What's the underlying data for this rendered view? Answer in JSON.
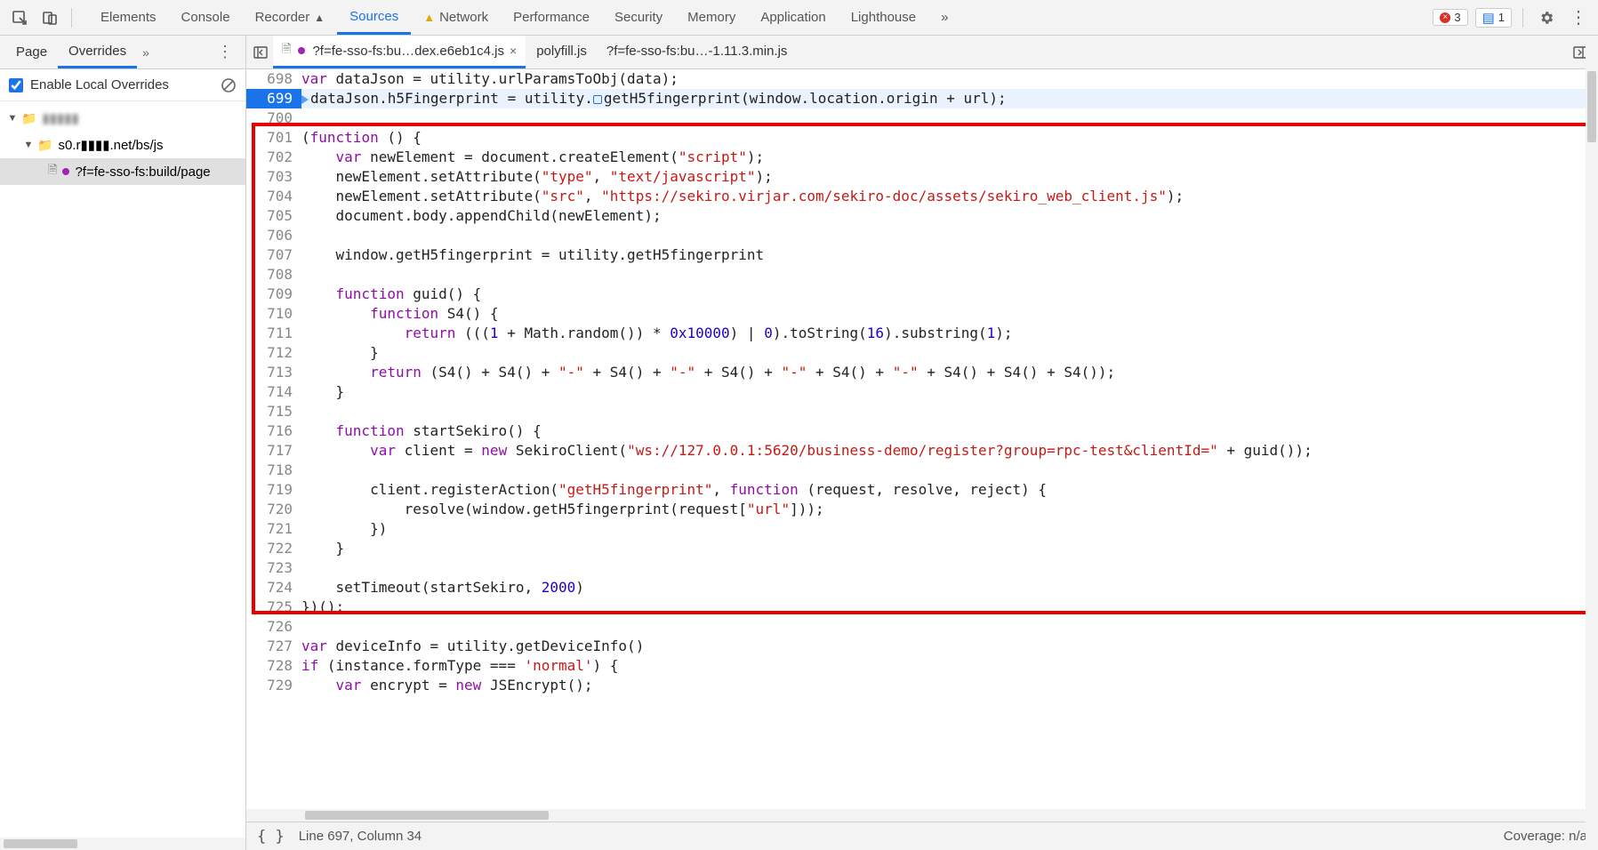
{
  "toolbar": {
    "tabs": [
      "Elements",
      "Console",
      "Recorder",
      "Sources",
      "Network",
      "Performance",
      "Security",
      "Memory",
      "Application",
      "Lighthouse"
    ],
    "active": 3,
    "recorder_flag": "▲",
    "network_warn": true,
    "more": "»",
    "error_count": "3",
    "msg_count": "1"
  },
  "sidebar": {
    "tabs": [
      "Page",
      "Overrides"
    ],
    "active": 1,
    "more": "»",
    "enable_overrides": "Enable Local Overrides",
    "tree": {
      "root_blur": "▮▮▮▮▮",
      "domain": "s0.r▮▮▮▮.net/bs/js",
      "file": "?f=fe-sso-fs:build/page"
    }
  },
  "editor": {
    "tabs": [
      "?f=fe-sso-fs:bu…dex.e6eb1c4.js",
      "polyfill.js",
      "?f=fe-sso-fs:bu…-1.11.3.min.js"
    ],
    "active": 0,
    "status_line": "Line 697, Column 34",
    "coverage": "Coverage: n/a",
    "first_line_no": 698,
    "lines": [
      {
        "n": 698,
        "seg": [
          [
            "kw",
            "var"
          ],
          [
            "plain",
            " dataJson "
          ],
          [
            "plain",
            "= utility.urlParamsToObj(data);"
          ]
        ]
      },
      {
        "n": 699,
        "hl": true,
        "bp": true,
        "seg": [
          [
            "plain",
            "dataJson.h5Fingerprint "
          ],
          [
            "plain",
            "= utility."
          ],
          [
            "brk",
            ""
          ],
          [
            "plain",
            "getH5fingerprint(window.location.origin "
          ],
          [
            "plain",
            "+ url);"
          ]
        ]
      },
      {
        "n": 700,
        "seg": []
      },
      {
        "n": 701,
        "seg": [
          [
            "plain",
            "("
          ],
          [
            "kw",
            "function"
          ],
          [
            "plain",
            " () {"
          ]
        ]
      },
      {
        "n": 702,
        "seg": [
          [
            "plain",
            "    "
          ],
          [
            "kw",
            "var"
          ],
          [
            "plain",
            " newElement "
          ],
          [
            "plain",
            "= document.createElement("
          ],
          [
            "str",
            "\"script\""
          ],
          [
            "plain",
            ");"
          ]
        ]
      },
      {
        "n": 703,
        "seg": [
          [
            "plain",
            "    newElement.setAttribute("
          ],
          [
            "str",
            "\"type\""
          ],
          [
            "plain",
            ", "
          ],
          [
            "str",
            "\"text/javascript\""
          ],
          [
            "plain",
            ");"
          ]
        ]
      },
      {
        "n": 704,
        "seg": [
          [
            "plain",
            "    newElement.setAttribute("
          ],
          [
            "str",
            "\"src\""
          ],
          [
            "plain",
            ", "
          ],
          [
            "str",
            "\"https://sekiro.virjar.com/sekiro-doc/assets/sekiro_web_client.js\""
          ],
          [
            "plain",
            ");"
          ]
        ]
      },
      {
        "n": 705,
        "seg": [
          [
            "plain",
            "    document.body.appendChild(newElement);"
          ]
        ]
      },
      {
        "n": 706,
        "seg": []
      },
      {
        "n": 707,
        "seg": [
          [
            "plain",
            "    window.getH5fingerprint "
          ],
          [
            "plain",
            "= utility.getH5fingerprint"
          ]
        ]
      },
      {
        "n": 708,
        "seg": []
      },
      {
        "n": 709,
        "seg": [
          [
            "plain",
            "    "
          ],
          [
            "kw",
            "function"
          ],
          [
            "plain",
            " guid() {"
          ]
        ]
      },
      {
        "n": 710,
        "seg": [
          [
            "plain",
            "        "
          ],
          [
            "kw",
            "function"
          ],
          [
            "plain",
            " S4() {"
          ]
        ]
      },
      {
        "n": 711,
        "seg": [
          [
            "plain",
            "            "
          ],
          [
            "kw",
            "return"
          ],
          [
            "plain",
            " ((("
          ],
          [
            "num",
            "1"
          ],
          [
            "plain",
            " + Math.random()) * "
          ],
          [
            "num",
            "0x10000"
          ],
          [
            "plain",
            ") | "
          ],
          [
            "num",
            "0"
          ],
          [
            "plain",
            ").toString("
          ],
          [
            "num",
            "16"
          ],
          [
            "plain",
            ").substring("
          ],
          [
            "num",
            "1"
          ],
          [
            "plain",
            ");"
          ]
        ]
      },
      {
        "n": 712,
        "seg": [
          [
            "plain",
            "        }"
          ]
        ]
      },
      {
        "n": 713,
        "seg": [
          [
            "plain",
            "        "
          ],
          [
            "kw",
            "return"
          ],
          [
            "plain",
            " (S4() + S4() + "
          ],
          [
            "str",
            "\"-\""
          ],
          [
            "plain",
            " + S4() + "
          ],
          [
            "str",
            "\"-\""
          ],
          [
            "plain",
            " + S4() + "
          ],
          [
            "str",
            "\"-\""
          ],
          [
            "plain",
            " + S4() + "
          ],
          [
            "str",
            "\"-\""
          ],
          [
            "plain",
            " + S4() + S4() + S4());"
          ]
        ]
      },
      {
        "n": 714,
        "seg": [
          [
            "plain",
            "    }"
          ]
        ]
      },
      {
        "n": 715,
        "seg": []
      },
      {
        "n": 716,
        "seg": [
          [
            "plain",
            "    "
          ],
          [
            "kw",
            "function"
          ],
          [
            "plain",
            " startSekiro() {"
          ]
        ]
      },
      {
        "n": 717,
        "seg": [
          [
            "plain",
            "        "
          ],
          [
            "kw",
            "var"
          ],
          [
            "plain",
            " client "
          ],
          [
            "plain",
            "= "
          ],
          [
            "kw",
            "new"
          ],
          [
            "plain",
            " SekiroClient("
          ],
          [
            "str",
            "\"ws://127.0.0.1:5620/business-demo/register?group=rpc-test&clientId=\""
          ],
          [
            "plain",
            " + guid());"
          ]
        ]
      },
      {
        "n": 718,
        "seg": []
      },
      {
        "n": 719,
        "seg": [
          [
            "plain",
            "        client.registerAction("
          ],
          [
            "str",
            "\"getH5fingerprint\""
          ],
          [
            "plain",
            ", "
          ],
          [
            "kw",
            "function"
          ],
          [
            "plain",
            " (request, resolve, reject) {"
          ]
        ]
      },
      {
        "n": 720,
        "seg": [
          [
            "plain",
            "            resolve(window.getH5fingerprint(request["
          ],
          [
            "str",
            "\"url\""
          ],
          [
            "plain",
            "]));"
          ]
        ]
      },
      {
        "n": 721,
        "seg": [
          [
            "plain",
            "        })"
          ]
        ]
      },
      {
        "n": 722,
        "seg": [
          [
            "plain",
            "    }"
          ]
        ]
      },
      {
        "n": 723,
        "seg": []
      },
      {
        "n": 724,
        "seg": [
          [
            "plain",
            "    setTimeout(startSekiro, "
          ],
          [
            "num",
            "2000"
          ],
          [
            "plain",
            ")"
          ]
        ]
      },
      {
        "n": 725,
        "seg": [
          [
            "plain",
            "})();"
          ]
        ]
      },
      {
        "n": 726,
        "seg": []
      },
      {
        "n": 727,
        "seg": [
          [
            "kw",
            "var"
          ],
          [
            "plain",
            " deviceInfo "
          ],
          [
            "plain",
            "= utility.getDeviceInfo()"
          ]
        ]
      },
      {
        "n": 728,
        "seg": [
          [
            "kw",
            "if"
          ],
          [
            "plain",
            " (instance.formType "
          ],
          [
            "plain",
            "=== "
          ],
          [
            "str",
            "'normal'"
          ],
          [
            "plain",
            ") {"
          ]
        ]
      },
      {
        "n": 729,
        "seg": [
          [
            "plain",
            "    "
          ],
          [
            "kw",
            "var"
          ],
          [
            "plain",
            " encrypt "
          ],
          [
            "plain",
            "= "
          ],
          [
            "kw",
            "new"
          ],
          [
            "plain",
            " JSEncrypt();"
          ]
        ]
      }
    ]
  }
}
